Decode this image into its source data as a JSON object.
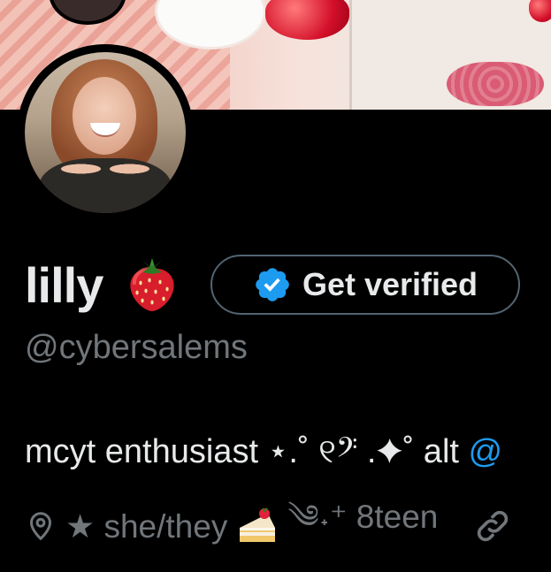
{
  "profile": {
    "display_name": "lilly",
    "name_emoji_icon": "strawberry-emoji",
    "handle": "@cybersalems",
    "verify_button_label": "Get verified",
    "bio_text": "mcyt enthusiast ⋆.˚ ୧𝄢 .✦˚ alt",
    "bio_link_fragment": "@",
    "meta_text": "★ she/they",
    "meta_emoji_icon": "shortcake-emoji",
    "meta_text_2": "༄˖⁺ 8teen"
  },
  "icons": {
    "location": "location-pin-icon",
    "link": "link-icon",
    "verified": "verified-badge-icon"
  },
  "colors": {
    "background": "#000000",
    "primary_text": "#e7e9ea",
    "secondary_text": "#71767b",
    "link": "#1d9bf0",
    "button_border": "#536471"
  }
}
